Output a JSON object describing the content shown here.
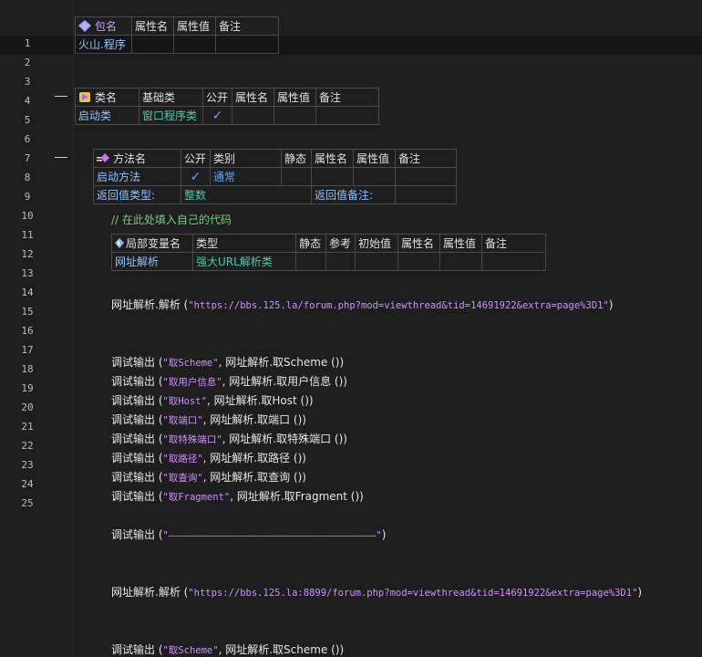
{
  "line_numbers": [
    "1",
    "2",
    "3",
    "4",
    "5",
    "6",
    "7",
    "8",
    "9",
    "10",
    "11",
    "12",
    "13",
    "14",
    "15",
    "16",
    "17",
    "18",
    "19",
    "20",
    "21",
    "22",
    "23",
    "24",
    "25"
  ],
  "package_table": {
    "headers": [
      "包名",
      "属性名",
      "属性值",
      "备注"
    ],
    "row": [
      "火山.程序",
      "",
      "",
      ""
    ]
  },
  "class_table": {
    "headers": [
      "类名",
      "基础类",
      "公开",
      "属性名",
      "属性值",
      "备注"
    ],
    "row": [
      "启动类",
      "窗口程序类",
      "✓",
      "",
      "",
      ""
    ]
  },
  "method_table": {
    "headers": [
      "方法名",
      "公开",
      "类别",
      "静态",
      "属性名",
      "属性值",
      "备注"
    ],
    "row": [
      "启动方法",
      "✓",
      "通常",
      "",
      "",
      "",
      ""
    ],
    "return_type_label": "返回值类型:",
    "return_type_value": "整数",
    "return_note_label": "返回值备注:"
  },
  "comment_line": "// 在此处填入自己的代码",
  "local_var_table": {
    "headers": [
      "局部变量名",
      "类型",
      "静态",
      "参考",
      "初始值",
      "属性名",
      "属性值",
      "备注"
    ],
    "row": [
      "网址解析",
      "强大URL解析类",
      "",
      "",
      "",
      "",
      "",
      ""
    ]
  },
  "code": {
    "l7_obj": "网址解析.解析 (",
    "l7_str": "\"https://bbs.125.la/forum.php?mod=viewthread&tid=14691922&extra=page%3D1\"",
    "l7_end": ")",
    "debug_fn": "调试输出 (",
    "debug_lines": [
      {
        "str": "\"取Scheme\"",
        "call": ", 网址解析.取Scheme ())"
      },
      {
        "str": "\"取用户信息\"",
        "call": ", 网址解析.取用户信息 ())"
      },
      {
        "str": "\"取Host\"",
        "call": ", 网址解析.取Host ())"
      },
      {
        "str": "\"取端口\"",
        "call": ", 网址解析.取端口 ())"
      },
      {
        "str": "\"取特殊端口\"",
        "call": ", 网址解析.取特殊端口 ())"
      },
      {
        "str": "\"取路径\"",
        "call": ", 网址解析.取路径 ())"
      },
      {
        "str": "\"取查询\"",
        "call": ", 网址解析.取查询 ())"
      },
      {
        "str": "\"取Fragment\"",
        "call": ", 网址解析.取Fragment ())"
      }
    ],
    "l19_str": "\"————————————————————————————————————\"",
    "l19_end": ")",
    "l22_obj": "网址解析.解析 (",
    "l22_str": "\"https://bbs.125.la:8899/forum.php?mod=viewthread&tid=14691922&extra=page%3D1\"",
    "l22_end": ")",
    "l25_str": "\"取Scheme\"",
    "l25_call": ", 网址解析.取Scheme ())"
  }
}
